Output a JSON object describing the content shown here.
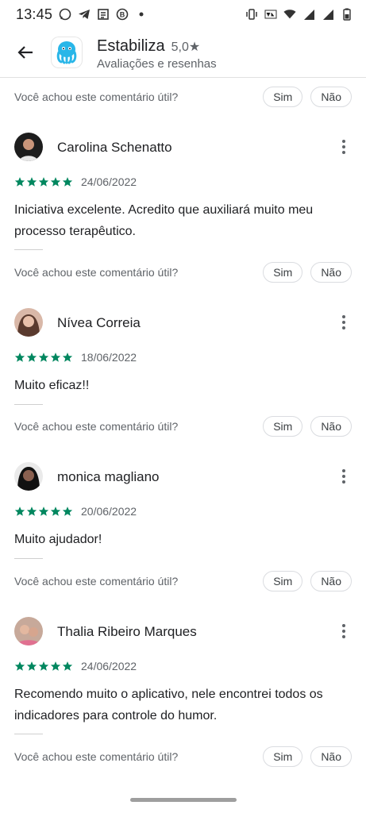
{
  "status": {
    "time": "13:45"
  },
  "header": {
    "app_name": "Estabiliza",
    "rating": "5,0★",
    "subtitle": "Avaliações e resenhas"
  },
  "helpful": {
    "question": "Você achou este comentário útil?",
    "yes": "Sim",
    "no": "Não"
  },
  "reviews": [
    {
      "name": "Carolina Schenatto",
      "date": "24/06/2022",
      "stars": 5,
      "text": "Iniciativa excelente. Acredito que auxiliará muito meu processo terapêutico."
    },
    {
      "name": "Nívea Correia",
      "date": "18/06/2022",
      "stars": 5,
      "text": "Muito eficaz!!"
    },
    {
      "name": "monica magliano",
      "date": "20/06/2022",
      "stars": 5,
      "text": "Muito ajudador!"
    },
    {
      "name": "Thalia Ribeiro Marques",
      "date": "24/06/2022",
      "stars": 5,
      "text": "Recomendo muito o aplicativo, nele encontrei todos os indicadores para controle do humor."
    }
  ],
  "colors": {
    "star": "#01875f",
    "divider": "#e0e0e0"
  }
}
